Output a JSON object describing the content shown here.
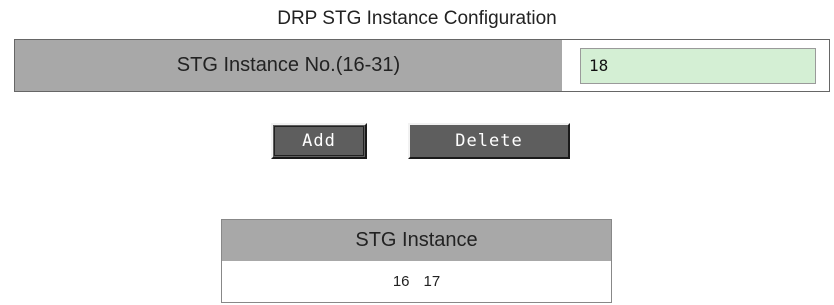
{
  "page": {
    "title": "DRP STG Instance Configuration"
  },
  "form": {
    "instance_label": "STG Instance No.(16-31)",
    "instance_value": "18"
  },
  "buttons": {
    "add_label": "Add",
    "delete_label": "Delete"
  },
  "instance_list": {
    "header": "STG Instance",
    "instances": [
      "16",
      "17"
    ]
  },
  "colors": {
    "header_background": "#a8a8a8",
    "input_background": "#d4efd4",
    "button_background": "#5e5e5e"
  }
}
